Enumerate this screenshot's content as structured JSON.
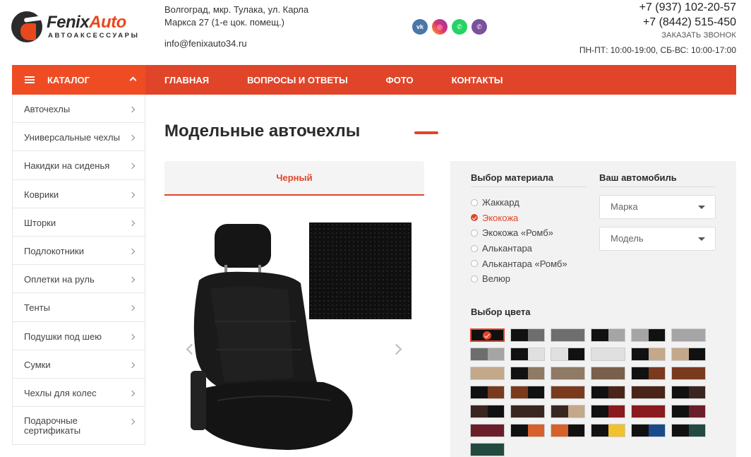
{
  "brand": {
    "name_a": "Fenix",
    "name_b": "Auto",
    "tagline": "АВТОАКСЕССУАРЫ"
  },
  "header": {
    "address": "Волгоград, мкр. Тулака, ул. Карла Маркса 27 (1-е цок. помещ.)",
    "email": "info@fenixauto34.ru",
    "phone1": "+7 (937) 102-20-57",
    "phone2": "+7 (8442) 515-450",
    "callback": "ЗАКАЗАТЬ ЗВОНОК",
    "hours": "ПН-ПТ: 10:00-19:00, СБ-ВС: 10:00-17:00",
    "socials": [
      "vk-icon",
      "instagram-icon",
      "whatsapp-icon",
      "viber-icon"
    ]
  },
  "nav": {
    "catalog": "КАТАЛОГ",
    "links": [
      "ГЛАВНАЯ",
      "ВОПРОСЫ И ОТВЕТЫ",
      "ФОТО",
      "КОНТАКТЫ"
    ]
  },
  "sidebar": {
    "items": [
      "Авточехлы",
      "Универсальные чехлы",
      "Накидки на сиденья",
      "Коврики",
      "Шторки",
      "Подлокотники",
      "Оплетки на руль",
      "Тенты",
      "Подушки под шею",
      "Сумки",
      "Чехлы для колес",
      "Подарочные сертификаты"
    ]
  },
  "main": {
    "title": "Модельные авточехлы",
    "color_tab": "Черный"
  },
  "panel": {
    "material_heading": "Выбор материала",
    "materials": [
      "Жаккард",
      "Экокожа",
      "Экокожа «Ромб»",
      "Алькантара",
      "Алькантара «Ромб»",
      "Велюр"
    ],
    "selected_material": "Экокожа",
    "car_heading": "Ваш автомобиль",
    "make_placeholder": "Марка",
    "model_placeholder": "Модель",
    "color_heading": "Выбор цвета",
    "swatches": [
      [
        "#111111",
        "#111111"
      ],
      [
        "#111111",
        "#6e6e6e"
      ],
      [
        "#6e6e6e",
        "#6e6e6e"
      ],
      [
        "#111111",
        "#a5a5a5"
      ],
      [
        "#a5a5a5",
        "#111111"
      ],
      [
        "#a5a5a5",
        "#a5a5a5"
      ],
      [
        "#6e6e6e",
        "#a5a5a5"
      ],
      [
        "#111111",
        "#e0e0e0"
      ],
      [
        "#e0e0e0",
        "#111111"
      ],
      [
        "#e0e0e0",
        "#e0e0e0"
      ],
      [
        "#111111",
        "#c4a88a"
      ],
      [
        "#c4a88a",
        "#111111"
      ],
      [
        "#c4a88a",
        "#c4a88a"
      ],
      [
        "#111111",
        "#8f7a66"
      ],
      [
        "#8f7a66",
        "#8f7a66"
      ],
      [
        "#7a5f4b",
        "#7a5f4b"
      ],
      [
        "#111111",
        "#7a3a1e"
      ],
      [
        "#7a3a1e",
        "#7a3a1e"
      ],
      [
        "#111111",
        "#7a3a1e"
      ],
      [
        "#7a3a1e",
        "#111111"
      ],
      [
        "#7a3a1e",
        "#7a3a1e"
      ],
      [
        "#111111",
        "#4a2418"
      ],
      [
        "#4a2418",
        "#4a2418"
      ],
      [
        "#111111",
        "#3a2620"
      ],
      [
        "#3a2620",
        "#111111"
      ],
      [
        "#3a2620",
        "#3a2620"
      ],
      [
        "#3a2620",
        "#c4a88a"
      ],
      [
        "#111111",
        "#8a1a1e"
      ],
      [
        "#8a1a1e",
        "#8a1a1e"
      ],
      [
        "#111111",
        "#6a1e2a"
      ],
      [
        "#6a1e2a",
        "#6a1e2a"
      ],
      [
        "#111111",
        "#d8602a"
      ],
      [
        "#d8602a",
        "#111111"
      ],
      [
        "#111111",
        "#f2c12e"
      ],
      [
        "#111111",
        "#1a4a8a"
      ],
      [
        "#111111",
        "#234a40"
      ],
      [
        "#234a40",
        "#234a40"
      ]
    ],
    "selected_color_index": 0
  }
}
